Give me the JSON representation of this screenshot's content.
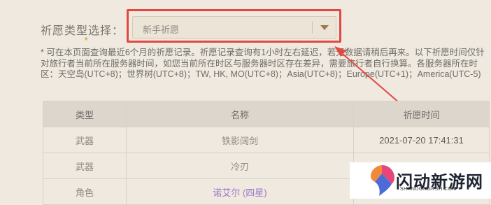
{
  "filter": {
    "label": "祈愿类型选择：",
    "selected": "新手祈愿"
  },
  "notice": "* 可在本页面查询最近6个月的祈愿记录。祈愿记录查询有1小时左右延迟，若无数据请稍后再来。以下祈愿时间仅针对旅行者当前所在服务器时间，如您当前所在时区与服务器时区存在差异，需要旅行者自行换算。各服务器所在时区：天空岛(UTC+8)；世界树(UTC+8)；TW, HK, MO(UTC+8)；Asia(UTC+8)；Europe(UTC+1)；America(UTC-5)",
  "table": {
    "headers": [
      "类型",
      "名称",
      "祈愿时间"
    ],
    "rows": [
      {
        "type": "武器",
        "name": "铁影阔剑",
        "time": "2021-07-20 17:41:31"
      },
      {
        "type": "武器",
        "name": "冷刃",
        "time": ""
      },
      {
        "type": "角色",
        "name": "诺艾尔 (四星)",
        "time": ""
      }
    ]
  },
  "watermark": {
    "title": "闪动新游网",
    "domain": "SHANDONGRSH.COM"
  },
  "colors": {
    "highlight": "#e2483f",
    "four_star": "#9d77c9"
  }
}
